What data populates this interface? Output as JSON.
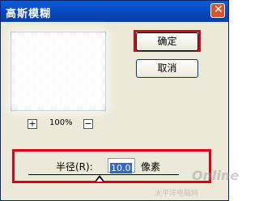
{
  "window": {
    "title": "高斯模糊",
    "close_glyph": "✕"
  },
  "preview": {
    "zoom_in_glyph": "+",
    "zoom_out_glyph": "−",
    "zoom_level": "100%"
  },
  "buttons": {
    "ok_label": "确定",
    "cancel_label": "取消"
  },
  "radius": {
    "label": "半径(R):",
    "value": "10.0",
    "unit": "像素",
    "slider_fraction": 0.47
  },
  "watermark": {
    "brand": "Online",
    "subtitle": "太平洋电脑网"
  },
  "colors": {
    "titlebar": "#0847bd",
    "highlight": "#e0001a",
    "selection": "#316ac5"
  }
}
